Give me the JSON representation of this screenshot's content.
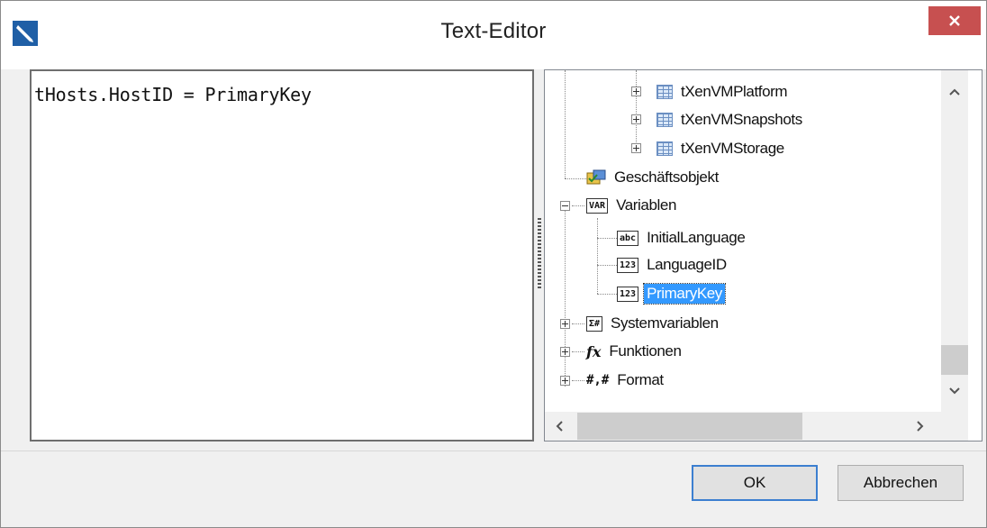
{
  "window": {
    "title": "Text-Editor",
    "icon": "pen-icon"
  },
  "editor": {
    "text": "tHosts.HostID = PrimaryKey"
  },
  "tree": {
    "items": [
      {
        "label": "tXenVMPlatform",
        "icon": "table-icon"
      },
      {
        "label": "tXenVMSnapshots",
        "icon": "table-icon"
      },
      {
        "label": "tXenVMStorage",
        "icon": "table-icon"
      },
      {
        "label": "Geschäftsobjekt",
        "icon": "business-object-icon"
      },
      {
        "label": "Variablen",
        "icon": "variables-icon",
        "icon_text": "VAR"
      },
      {
        "label": "InitialLanguage",
        "icon": "string-variable-icon",
        "icon_text": "abc"
      },
      {
        "label": "LanguageID",
        "icon": "number-variable-icon",
        "icon_text": "123"
      },
      {
        "label": "PrimaryKey",
        "icon": "number-variable-icon",
        "icon_text": "123",
        "selected": true
      },
      {
        "label": "Systemvariablen",
        "icon": "system-variables-icon",
        "icon_text": "Σ#"
      },
      {
        "label": "Funktionen",
        "icon": "function-icon",
        "icon_text": "fx"
      },
      {
        "label": "Format",
        "icon": "format-icon",
        "icon_text": "#,#"
      }
    ]
  },
  "buttons": {
    "ok": "OK",
    "cancel": "Abbrechen"
  },
  "colors": {
    "close": "#c75050",
    "selection": "#3399ff",
    "default_button_border": "#3c7fd0"
  }
}
